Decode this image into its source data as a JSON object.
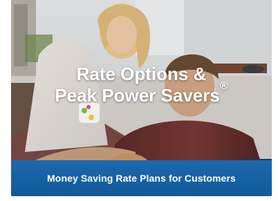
{
  "hero": {
    "title_line1": "Rate Options &",
    "title_line2": "Peak Power Savers",
    "trademark": "®",
    "photo_label": "family-in-kitchen-photo"
  },
  "banner": {
    "label": "Money Saving Rate Plans for Customers",
    "color": "#1a65a8"
  }
}
